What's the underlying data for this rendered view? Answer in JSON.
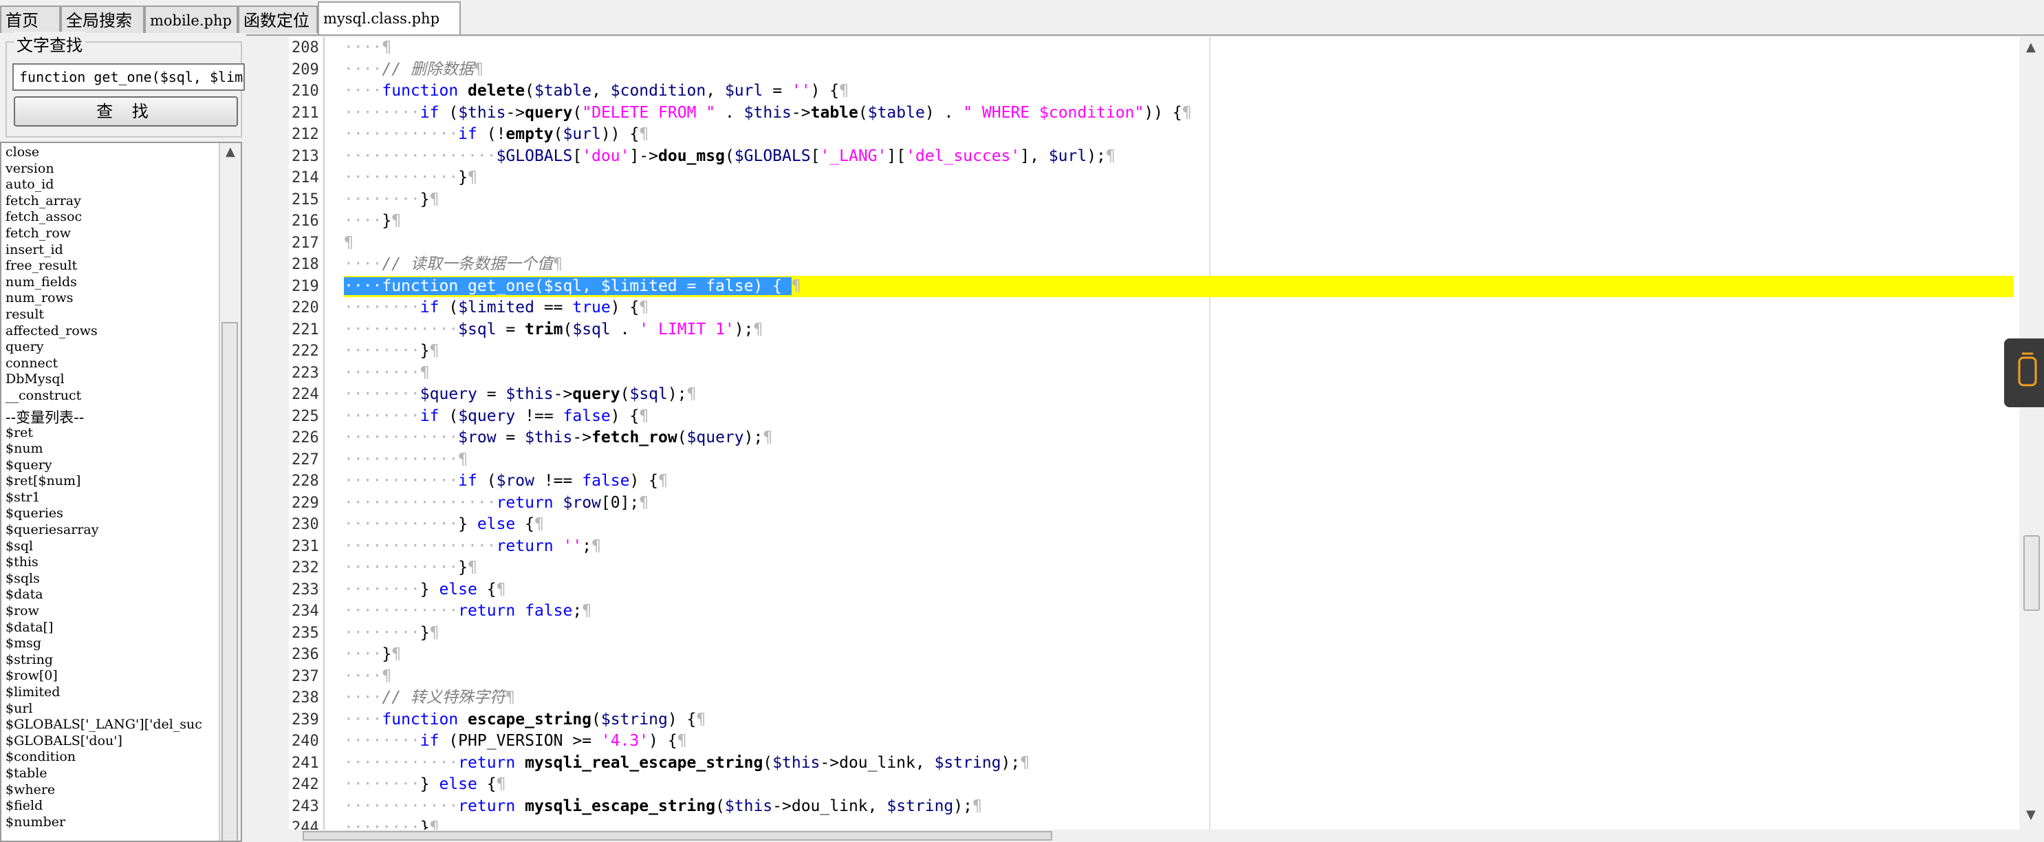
{
  "tabs": [
    "首页",
    "全局搜索",
    "mobile.php",
    "函数定位",
    "mysql.class.php"
  ],
  "find": {
    "title": "文字查找",
    "input_value": "function get_one($sql, $limi",
    "button": "查 找"
  },
  "functions": [
    "close",
    "version",
    "auto_id",
    "fetch_array",
    "fetch_assoc",
    "fetch_row",
    "insert_id",
    "free_result",
    "num_fields",
    "num_rows",
    "result",
    "affected_rows",
    "query",
    "connect",
    "DbMysql",
    "__construct"
  ],
  "var_header": "--变量列表--",
  "variables": [
    "$ret",
    "$num",
    "$query",
    "$ret[$num]",
    "$str1",
    "$queries",
    "$queriesarray",
    "$sql",
    "$this",
    "$sqls",
    "$data",
    "$row",
    "$data[]",
    "$msg",
    "$string",
    "$row[0]",
    "$limited",
    "$url",
    "$GLOBALS['_LANG']['del_suc",
    "$GLOBALS['dou']",
    "$condition",
    "$table",
    "$where",
    "$field",
    "$number"
  ],
  "line_numbers": [
    "208",
    "209",
    "210",
    "211",
    "212",
    "213",
    "214",
    "215",
    "216",
    "217",
    "218",
    "219",
    "220",
    "221",
    "222",
    "223",
    "224",
    "225",
    "226",
    "227",
    "228",
    "229",
    "230",
    "231",
    "232",
    "233",
    "234",
    "235",
    "236",
    "237",
    "238",
    "239",
    "240",
    "241",
    "242",
    "243",
    "244"
  ],
  "code": [
    {
      "i": 1,
      "t": []
    },
    {
      "i": 1,
      "t": [
        [
          "cm",
          "// 删除数据"
        ]
      ]
    },
    {
      "i": 1,
      "t": [
        [
          "kw",
          "function "
        ],
        [
          "fn",
          "delete"
        ],
        [
          "",
          "("
        ],
        [
          "vr",
          "$table"
        ],
        [
          "",
          ", "
        ],
        [
          "vr",
          "$condition"
        ],
        [
          "",
          ", "
        ],
        [
          "vr",
          "$url"
        ],
        [
          "",
          " = "
        ],
        [
          "st",
          "''"
        ],
        [
          "",
          ") {"
        ]
      ]
    },
    {
      "i": 2,
      "t": [
        [
          "kw",
          "if "
        ],
        [
          "",
          "("
        ],
        [
          "vr",
          "$this"
        ],
        [
          "",
          "->"
        ],
        [
          "fn",
          "query"
        ],
        [
          "",
          "("
        ],
        [
          "st",
          "\"DELETE FROM \""
        ],
        [
          "",
          " . "
        ],
        [
          "vr",
          "$this"
        ],
        [
          "",
          "->"
        ],
        [
          "fn",
          "table"
        ],
        [
          "",
          "("
        ],
        [
          "vr",
          "$table"
        ],
        [
          "",
          ") . "
        ],
        [
          "st",
          "\" WHERE $condition\""
        ],
        [
          "",
          ")) {"
        ]
      ]
    },
    {
      "i": 3,
      "t": [
        [
          "kw",
          "if "
        ],
        [
          "",
          "(!"
        ],
        [
          "fn",
          "empty"
        ],
        [
          "",
          "("
        ],
        [
          "vr",
          "$url"
        ],
        [
          "",
          ")) {"
        ]
      ]
    },
    {
      "i": 4,
      "t": [
        [
          "vr",
          "$GLOBALS"
        ],
        [
          "",
          "["
        ],
        [
          "st",
          "'dou'"
        ],
        [
          "",
          "]->"
        ],
        [
          "fn",
          "dou_msg"
        ],
        [
          "",
          "("
        ],
        [
          "vr",
          "$GLOBALS"
        ],
        [
          "",
          "["
        ],
        [
          "st",
          "'_LANG'"
        ],
        [
          "",
          "]["
        ],
        [
          "st",
          "'del_succes'"
        ],
        [
          "",
          "], "
        ],
        [
          "vr",
          "$url"
        ],
        [
          "",
          ");"
        ]
      ]
    },
    {
      "i": 3,
      "t": [
        [
          "",
          "}"
        ]
      ]
    },
    {
      "i": 2,
      "t": [
        [
          "",
          "}"
        ]
      ]
    },
    {
      "i": 1,
      "t": [
        [
          "",
          "}"
        ]
      ]
    },
    {
      "i": 0,
      "t": []
    },
    {
      "i": 1,
      "t": [
        [
          "cm",
          "// 读取一条数据一个值"
        ]
      ]
    },
    {
      "i": 1,
      "sel": true,
      "t": [
        [
          "",
          "function get_one($sql, $limited = false) {"
        ]
      ]
    },
    {
      "i": 2,
      "t": [
        [
          "kw",
          "if "
        ],
        [
          "",
          "("
        ],
        [
          "vr",
          "$limited"
        ],
        [
          "",
          " == "
        ],
        [
          "kw",
          "true"
        ],
        [
          "",
          ") {"
        ]
      ]
    },
    {
      "i": 3,
      "t": [
        [
          "vr",
          "$sql"
        ],
        [
          "",
          " = "
        ],
        [
          "fn",
          "trim"
        ],
        [
          "",
          "("
        ],
        [
          "vr",
          "$sql"
        ],
        [
          "",
          " . "
        ],
        [
          "st",
          "' LIMIT 1'"
        ],
        [
          "",
          ");"
        ]
      ]
    },
    {
      "i": 2,
      "t": [
        [
          "",
          "}"
        ]
      ]
    },
    {
      "i": 2,
      "t": []
    },
    {
      "i": 2,
      "t": [
        [
          "vr",
          "$query"
        ],
        [
          "",
          " = "
        ],
        [
          "vr",
          "$this"
        ],
        [
          "",
          "->"
        ],
        [
          "fn",
          "query"
        ],
        [
          "",
          "("
        ],
        [
          "vr",
          "$sql"
        ],
        [
          "",
          ");"
        ]
      ]
    },
    {
      "i": 2,
      "t": [
        [
          "kw",
          "if "
        ],
        [
          "",
          "("
        ],
        [
          "vr",
          "$query"
        ],
        [
          "",
          " !== "
        ],
        [
          "kw",
          "false"
        ],
        [
          "",
          ") {"
        ]
      ]
    },
    {
      "i": 3,
      "t": [
        [
          "vr",
          "$row"
        ],
        [
          "",
          " = "
        ],
        [
          "vr",
          "$this"
        ],
        [
          "",
          "->"
        ],
        [
          "fn",
          "fetch_row"
        ],
        [
          "",
          "("
        ],
        [
          "vr",
          "$query"
        ],
        [
          "",
          ");"
        ]
      ]
    },
    {
      "i": 3,
      "t": []
    },
    {
      "i": 3,
      "t": [
        [
          "kw",
          "if "
        ],
        [
          "",
          "("
        ],
        [
          "vr",
          "$row"
        ],
        [
          "",
          " !== "
        ],
        [
          "kw",
          "false"
        ],
        [
          "",
          ") {"
        ]
      ]
    },
    {
      "i": 4,
      "t": [
        [
          "kw",
          "return "
        ],
        [
          "vr",
          "$row"
        ],
        [
          "",
          "[0];"
        ]
      ]
    },
    {
      "i": 3,
      "t": [
        [
          "",
          "} "
        ],
        [
          "kw",
          "else "
        ],
        [
          "",
          "{"
        ]
      ]
    },
    {
      "i": 4,
      "t": [
        [
          "kw",
          "return "
        ],
        [
          "st",
          "''"
        ],
        [
          "",
          ";"
        ]
      ]
    },
    {
      "i": 3,
      "t": [
        [
          "",
          "}"
        ]
      ]
    },
    {
      "i": 2,
      "t": [
        [
          "",
          "} "
        ],
        [
          "kw",
          "else "
        ],
        [
          "",
          "{"
        ]
      ]
    },
    {
      "i": 3,
      "t": [
        [
          "kw",
          "return "
        ],
        [
          "kw",
          "false"
        ],
        [
          "",
          ";"
        ]
      ]
    },
    {
      "i": 2,
      "t": [
        [
          "",
          "}"
        ]
      ]
    },
    {
      "i": 1,
      "t": [
        [
          "",
          "}"
        ]
      ]
    },
    {
      "i": 1,
      "t": []
    },
    {
      "i": 1,
      "t": [
        [
          "cm",
          "// 转义特殊字符"
        ]
      ]
    },
    {
      "i": 1,
      "t": [
        [
          "kw",
          "function "
        ],
        [
          "fn",
          "escape_string"
        ],
        [
          "",
          "("
        ],
        [
          "vr",
          "$string"
        ],
        [
          "",
          ") {"
        ]
      ]
    },
    {
      "i": 2,
      "t": [
        [
          "kw",
          "if "
        ],
        [
          "",
          "(PHP_VERSION >= "
        ],
        [
          "st",
          "'4.3'"
        ],
        [
          "",
          ") {"
        ]
      ]
    },
    {
      "i": 3,
      "t": [
        [
          "kw",
          "return "
        ],
        [
          "fn",
          "mysqli_real_escape_string"
        ],
        [
          "",
          "("
        ],
        [
          "vr",
          "$this"
        ],
        [
          "",
          "->dou_link, "
        ],
        [
          "vr",
          "$string"
        ],
        [
          "",
          ");"
        ]
      ]
    },
    {
      "i": 2,
      "t": [
        [
          "",
          "} "
        ],
        [
          "kw",
          "else "
        ],
        [
          "",
          "{"
        ]
      ]
    },
    {
      "i": 3,
      "t": [
        [
          "kw",
          "return "
        ],
        [
          "fn",
          "mysqli_escape_string"
        ],
        [
          "",
          "("
        ],
        [
          "vr",
          "$this"
        ],
        [
          "",
          "->dou_link, "
        ],
        [
          "vr",
          "$string"
        ],
        [
          "",
          ");"
        ]
      ]
    },
    {
      "i": 2,
      "t": [
        [
          "",
          "}"
        ]
      ]
    }
  ],
  "colors": {
    "highlight": "#ffff00",
    "selection": "#3399ff",
    "keyword": "#0000ff",
    "string": "#ff00ff",
    "comment": "#808080"
  }
}
